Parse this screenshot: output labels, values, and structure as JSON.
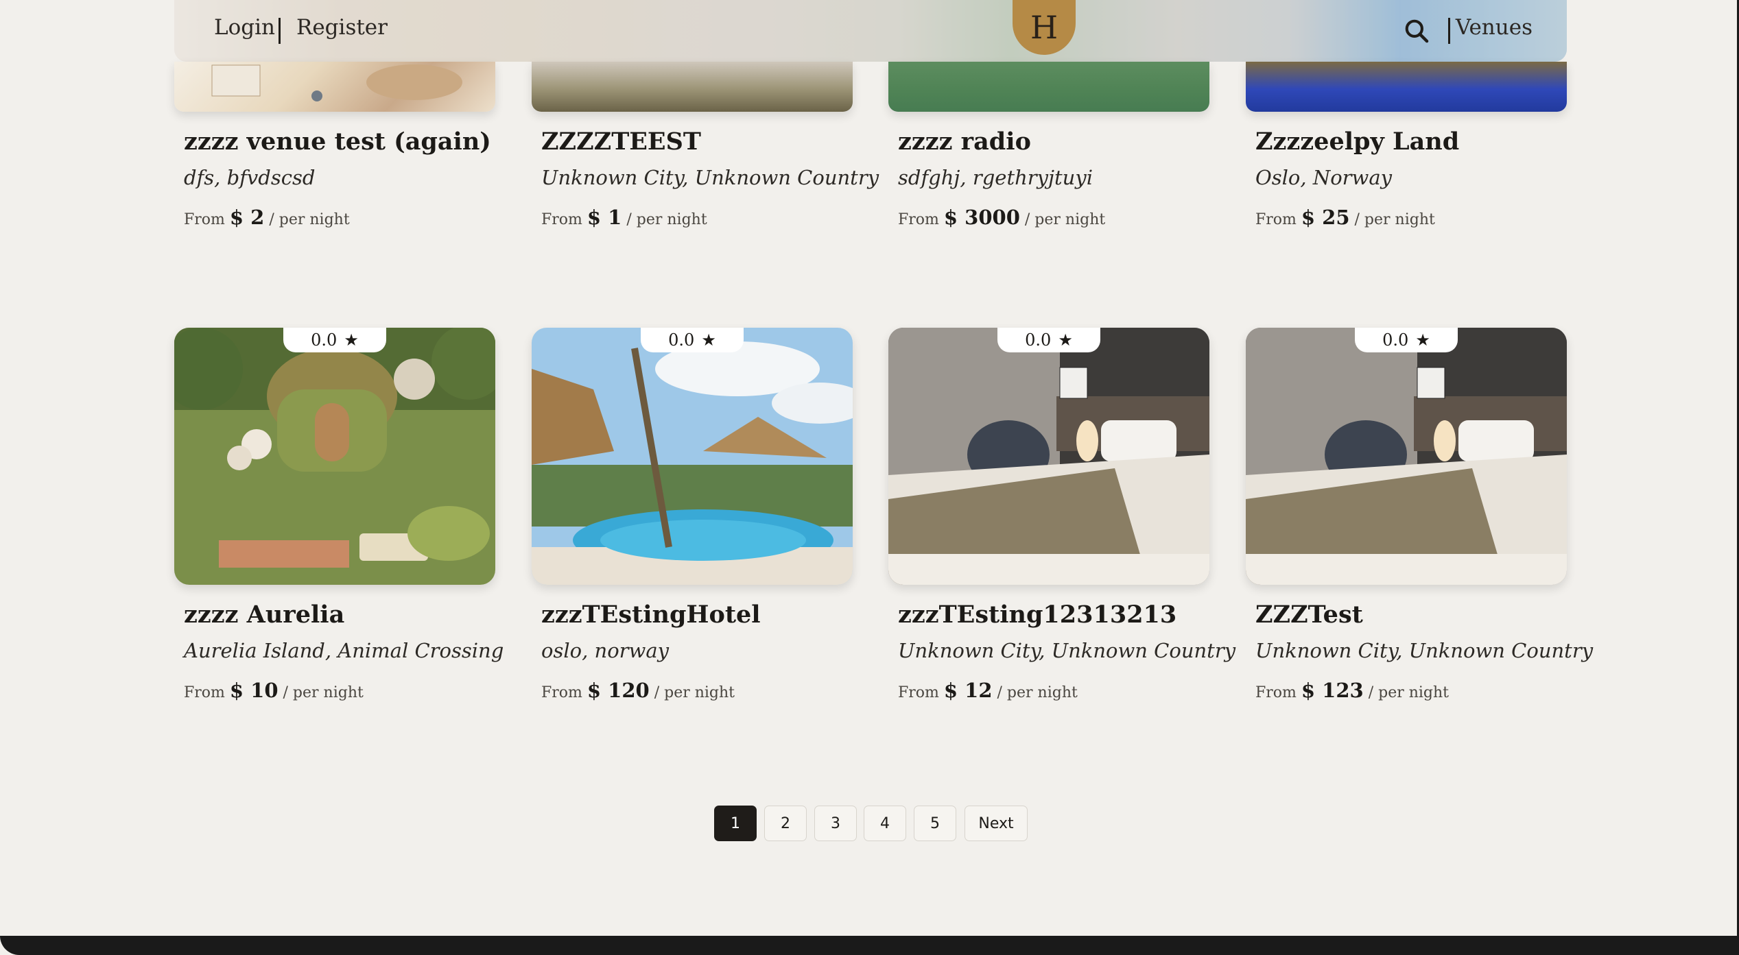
{
  "header": {
    "login": "Login",
    "register": "Register",
    "logo": "H",
    "venues": "Venues",
    "search_icon": "search-icon"
  },
  "venues_row1": [
    {
      "name": "zzzz venue test (again)",
      "location": "dfs, bfvdscsd",
      "from": "From",
      "price": "$ 2",
      "per": "/ per night"
    },
    {
      "name": "ZZZZTEEST",
      "location": "Unknown City, Unknown Country",
      "from": "From",
      "price": "$ 1",
      "per": "/ per night"
    },
    {
      "name": "zzzz radio",
      "location": "sdfghj, rgethryjtuyi",
      "from": "From",
      "price": "$ 3000",
      "per": "/ per night"
    },
    {
      "name": "Zzzzeelpy Land",
      "location": "Oslo, Norway",
      "from": "From",
      "price": "$ 25",
      "per": "/ per night"
    }
  ],
  "venues_row2": [
    {
      "rating": "0.0",
      "name": "zzzz Aurelia",
      "location": "Aurelia Island, Animal Crossing",
      "from": "From",
      "price": "$ 10",
      "per": "/ per night"
    },
    {
      "rating": "0.0",
      "name": "zzzTEstingHotel",
      "location": "oslo, norway",
      "from": "From",
      "price": "$ 120",
      "per": "/ per night"
    },
    {
      "rating": "0.0",
      "name": "zzzTEsting12313213",
      "location": "Unknown City, Unknown Country",
      "from": "From",
      "price": "$ 12",
      "per": "/ per night"
    },
    {
      "rating": "0.0",
      "name": "ZZZTest",
      "location": "Unknown City, Unknown Country",
      "from": "From",
      "price": "$ 123",
      "per": "/ per night"
    }
  ],
  "star": "★",
  "pagination": {
    "pages": [
      "1",
      "2",
      "3",
      "4",
      "5"
    ],
    "next": "Next",
    "current": "1"
  },
  "colors": {
    "background": "#f2f0ec",
    "logo": "#b98a3e",
    "active_page": "#1f1c19"
  }
}
